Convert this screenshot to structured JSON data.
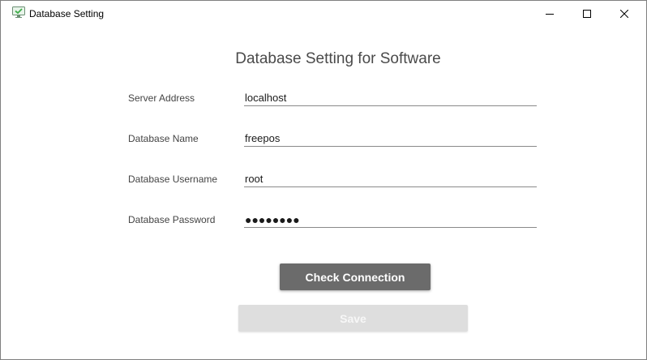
{
  "window": {
    "title": "Database Setting",
    "app_icon": "monitor-check-icon",
    "controls": {
      "minimize_icon": "minimize-icon",
      "maximize_icon": "maximize-icon",
      "close_icon": "close-icon"
    }
  },
  "form": {
    "heading": "Database Setting for Software",
    "fields": [
      {
        "label": "Server Address",
        "value": "localhost"
      },
      {
        "label": "Database Name",
        "value": "freepos"
      },
      {
        "label": "Database Username",
        "value": "root"
      },
      {
        "label": "Database Password",
        "value": "●●●●●●●●"
      }
    ],
    "check_button_label": "Check Connection",
    "save_button_label": "Save",
    "save_enabled": false
  },
  "colors": {
    "check_button_bg": "#6b6b6b",
    "save_button_bg": "#dedede",
    "icon_green": "#3fae49"
  }
}
